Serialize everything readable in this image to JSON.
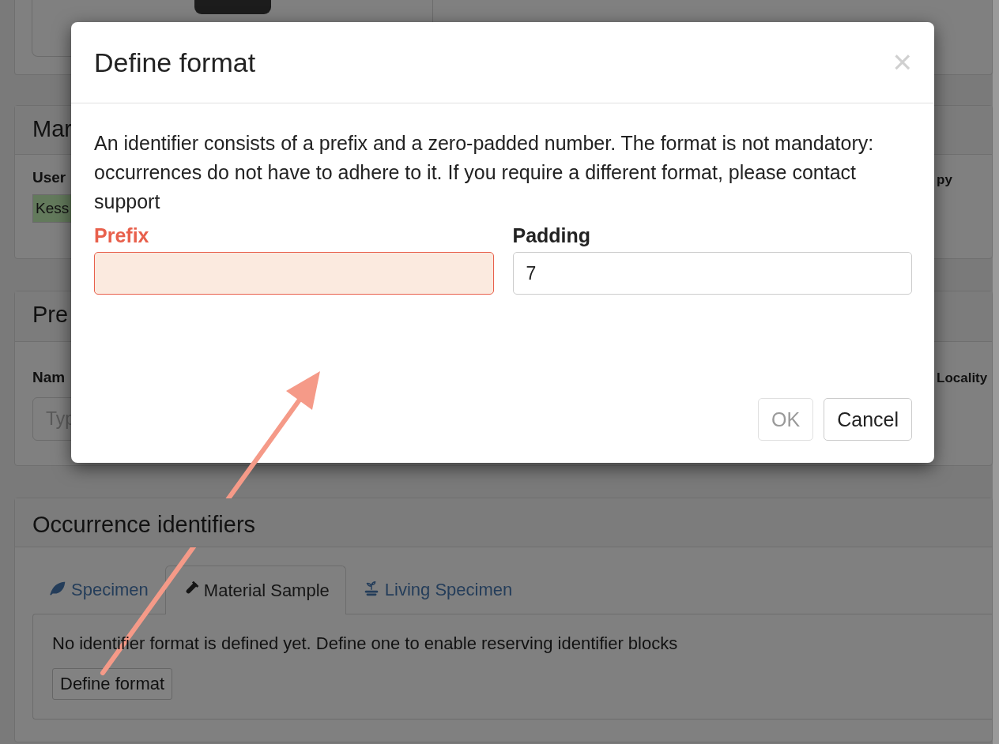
{
  "page": {
    "user_panel": {
      "title": "Mar",
      "user_label": "User",
      "user_value": "Kess",
      "column_2_label": "py"
    },
    "preparation_panel": {
      "title": "Pre",
      "name_label": "Nam",
      "name_placeholder": "Typ",
      "locality_label": "Locality"
    },
    "identifiers_panel": {
      "title": "Occurrence identifiers",
      "tabs": [
        {
          "label": "Specimen",
          "selected": false
        },
        {
          "label": "Material Sample",
          "selected": true
        },
        {
          "label": "Living Specimen",
          "selected": false
        }
      ],
      "message": "No identifier format is defined yet. Define one to enable reserving identifier blocks",
      "button": "Define format"
    }
  },
  "dialog": {
    "title": "Define format",
    "close": "×",
    "description": "An identifier consists of a prefix and a zero-padded number. The format is not mandatory: occurrences do not have to adhere to it. If you require a different format, please contact support",
    "fields": [
      {
        "label": "Prefix",
        "invalid": true
      },
      {
        "label": "Padding",
        "value": "7",
        "invalid": false
      }
    ],
    "buttons": [
      {
        "label": "OK",
        "disabled": true
      },
      {
        "label": "Cancel",
        "disabled": false
      }
    ]
  }
}
